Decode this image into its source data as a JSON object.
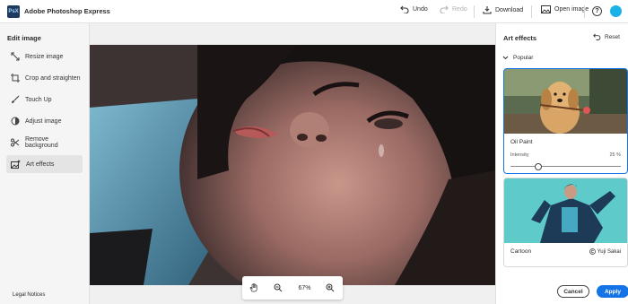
{
  "header": {
    "logo_text": "PsX",
    "app_title": "Adobe Photoshop Express",
    "undo": "Undo",
    "redo": "Redo",
    "download": "Download",
    "open_image": "Open image",
    "help": "?"
  },
  "sidebar": {
    "title": "Edit image",
    "items": [
      {
        "label": "Resize image",
        "icon": "resize-icon"
      },
      {
        "label": "Crop and straighten",
        "icon": "crop-icon"
      },
      {
        "label": "Touch Up",
        "icon": "brush-icon"
      },
      {
        "label": "Adjust image",
        "icon": "adjust-icon"
      },
      {
        "label": "Remove background",
        "icon": "scissors-icon"
      },
      {
        "label": "Art effects",
        "icon": "art-effects-icon",
        "active": true
      }
    ],
    "legal": "Legal Notices"
  },
  "canvas": {
    "zoom": "67%"
  },
  "panel": {
    "title": "Art effects",
    "reset": "Reset",
    "section": "Popular",
    "effects": [
      {
        "name": "Oil Paint",
        "intensity_label": "Intensity",
        "intensity_value": "25 %",
        "intensity": 0.25,
        "selected": true
      },
      {
        "name": "Cartoon",
        "credit": "Yuji Sakai"
      }
    ],
    "cancel": "Cancel",
    "apply": "Apply"
  },
  "colors": {
    "accent": "#1473e6",
    "avatar": "#1ab1e8"
  }
}
